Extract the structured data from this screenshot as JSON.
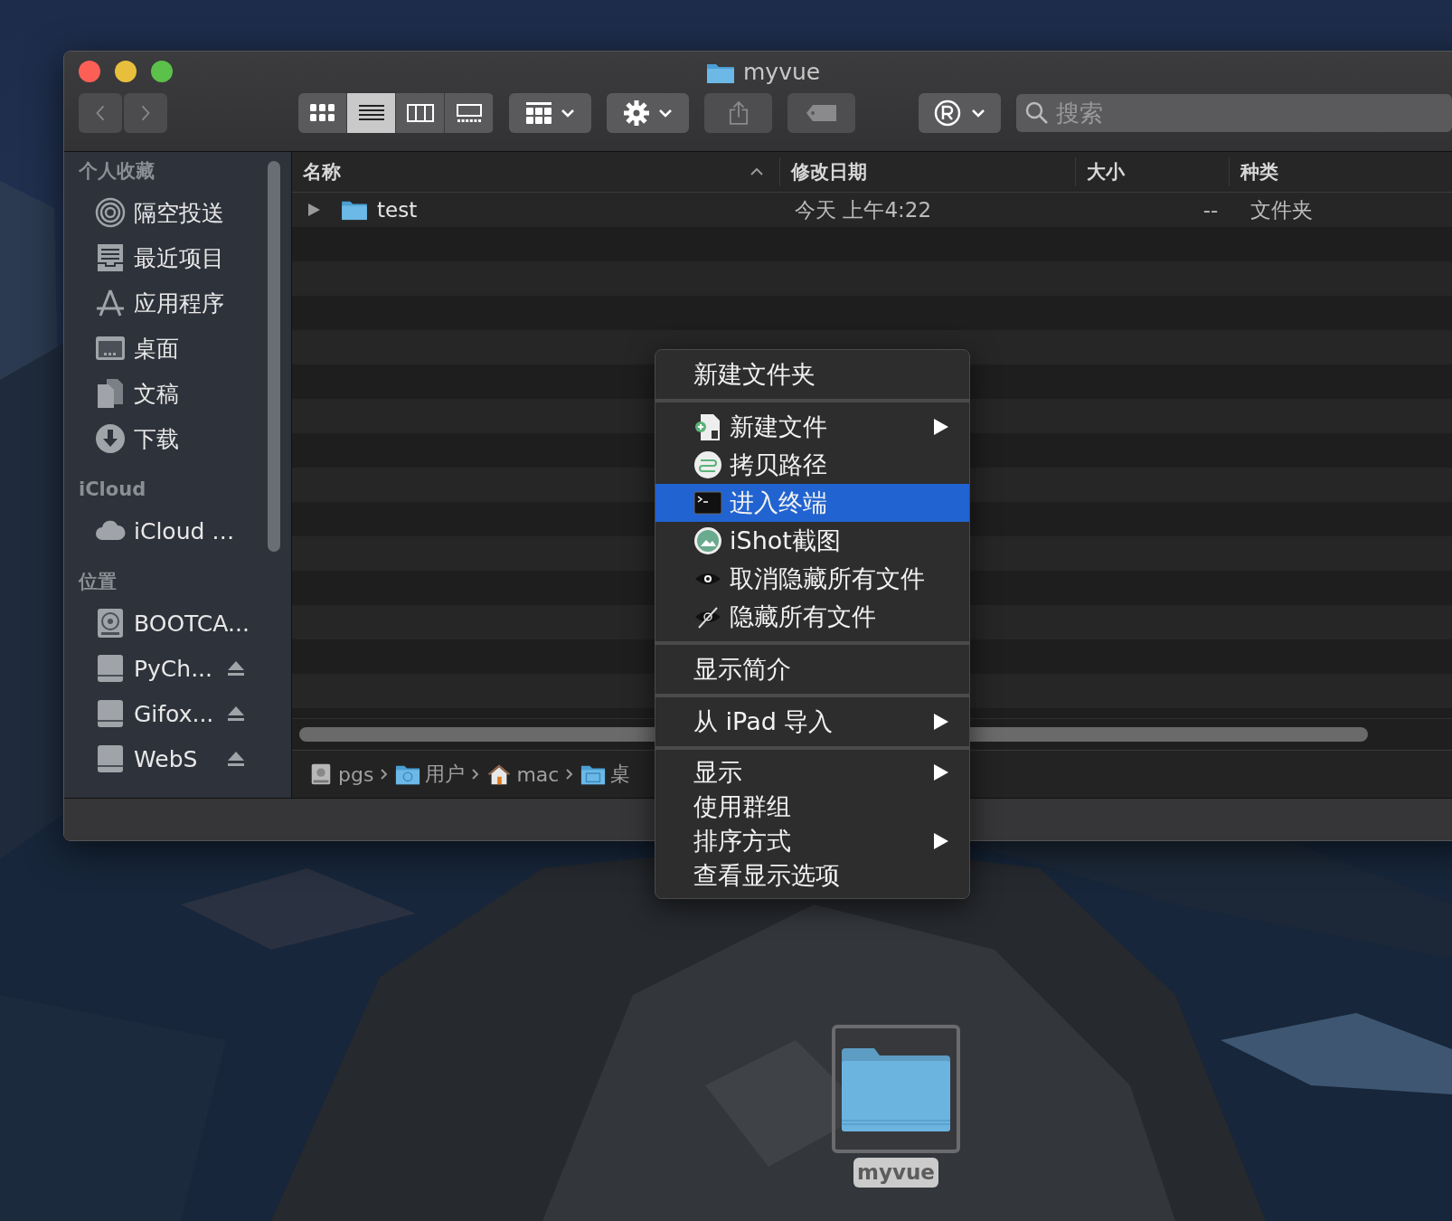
{
  "window": {
    "title": "myvue"
  },
  "toolbar": {
    "view_modes": [
      {
        "kind": "icons",
        "selected": false
      },
      {
        "kind": "list",
        "selected": true
      },
      {
        "kind": "columns",
        "selected": false
      },
      {
        "kind": "gallery",
        "selected": false
      }
    ],
    "search": {
      "placeholder": "搜索"
    }
  },
  "sidebar": {
    "sections": [
      {
        "heading": "个人收藏",
        "items": [
          {
            "label": "隔空投送",
            "kind": "airdrop",
            "eject": false
          },
          {
            "label": "最近项目",
            "kind": "recents",
            "eject": false
          },
          {
            "label": "应用程序",
            "kind": "apps",
            "eject": false
          },
          {
            "label": "桌面",
            "kind": "desktop",
            "eject": false
          },
          {
            "label": "文稿",
            "kind": "documents",
            "eject": false
          },
          {
            "label": "下载",
            "kind": "downloads",
            "eject": false
          }
        ]
      },
      {
        "heading": "iCloud",
        "items": [
          {
            "label": "iCloud …",
            "kind": "icloud",
            "eject": false
          }
        ]
      },
      {
        "heading": "位置",
        "items": [
          {
            "label": "BOOTCA...",
            "kind": "bootcamp",
            "eject": false
          },
          {
            "label": "PyCh...",
            "kind": "drive",
            "eject": true
          },
          {
            "label": "Gifox...",
            "kind": "drive",
            "eject": true
          },
          {
            "label": "WebS",
            "kind": "drive",
            "eject": true
          }
        ]
      }
    ]
  },
  "table": {
    "columns": [
      {
        "label": "名称",
        "sorted": true
      },
      {
        "label": "修改日期",
        "sorted": false
      },
      {
        "label": "大小",
        "sorted": false
      },
      {
        "label": "种类",
        "sorted": false
      }
    ],
    "rows": [
      {
        "name": "test",
        "modified": "今天 上午4:22",
        "size": "--",
        "kind": "文件夹",
        "expanded": false
      }
    ]
  },
  "path_bar": [
    {
      "label": "pgs",
      "kind": "disk"
    },
    {
      "label": "用户",
      "kind": "users"
    },
    {
      "label": "mac",
      "kind": "home"
    },
    {
      "label": "桌",
      "kind": "folder"
    }
  ],
  "context_menu": {
    "groups": [
      [
        {
          "label": "新建文件夹",
          "kind": "plain",
          "submenu": false,
          "selected": false
        }
      ],
      [
        {
          "label": "新建文件",
          "kind": "newfile",
          "submenu": true,
          "selected": false
        },
        {
          "label": "拷贝路径",
          "kind": "copypath",
          "submenu": false,
          "selected": false
        },
        {
          "label": "进入终端",
          "kind": "terminal",
          "submenu": false,
          "selected": true
        },
        {
          "label": "iShot截图",
          "kind": "ishot",
          "submenu": false,
          "selected": false
        },
        {
          "label": "取消隐藏所有文件",
          "kind": "eye",
          "submenu": false,
          "selected": false
        },
        {
          "label": "隐藏所有文件",
          "kind": "eyeoff",
          "submenu": false,
          "selected": false
        }
      ],
      [
        {
          "label": "显示简介",
          "kind": "plain",
          "submenu": false,
          "selected": false
        }
      ],
      [
        {
          "label": "从 iPad 导入",
          "kind": "plain",
          "submenu": true,
          "selected": false
        }
      ],
      [
        {
          "label": "显示",
          "kind": "plain",
          "submenu": true,
          "selected": false
        },
        {
          "label": "使用群组",
          "kind": "plain",
          "submenu": false,
          "selected": false
        },
        {
          "label": "排序方式",
          "kind": "plain",
          "submenu": true,
          "selected": false
        },
        {
          "label": "查看显示选项",
          "kind": "plain",
          "submenu": false,
          "selected": false
        }
      ]
    ]
  },
  "desktop_icon": {
    "label": "myvue",
    "selected": true
  }
}
